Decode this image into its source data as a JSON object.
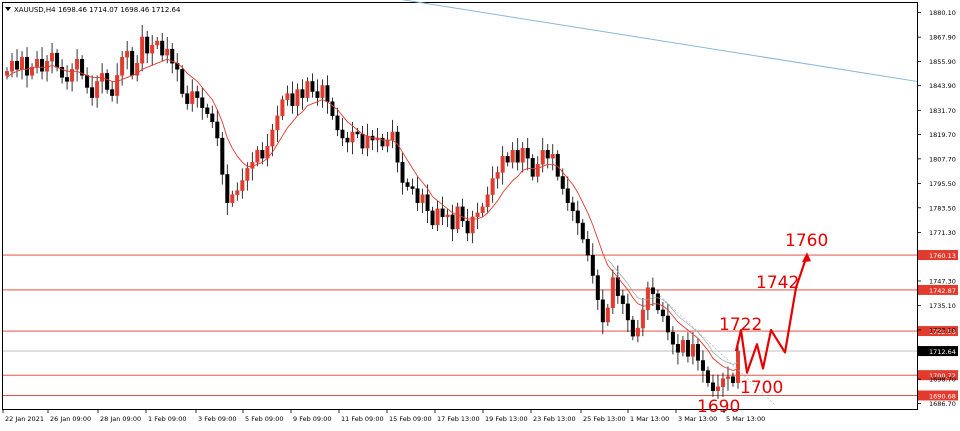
{
  "header": {
    "symbol": "XAUUSD,H4",
    "ohlc": "1698.46 1714.07 1698.46 1712.64"
  },
  "chart_data": {
    "type": "candlestick",
    "ylim": [
      1684,
      1892
    ],
    "y_ticks": [
      1880.1,
      1867.9,
      1855.9,
      1843.9,
      1831.7,
      1819.7,
      1807.7,
      1795.5,
      1783.5,
      1771.3,
      1747.3,
      1735.1,
      1723.1,
      1698.7,
      1686.7
    ],
    "x_labels": [
      "22 Jan 2021",
      "26 Jan 09:00",
      "28 Jan 09:00",
      "1 Feb 09:00",
      "3 Feb 09:00",
      "5 Feb 09:00",
      "9 Feb 09:00",
      "11 Feb 09:00",
      "15 Feb 09:00",
      "17 Feb 13:00",
      "19 Feb 13:00",
      "23 Feb 13:00",
      "25 Feb 13:00",
      "1 Mar 13:00",
      "3 Mar 13:00",
      "5 Mar 13:00"
    ],
    "levels": [
      {
        "label": "1760.13",
        "value": 1760.13
      },
      {
        "label": "1742.87",
        "value": 1742.87
      },
      {
        "label": "1722.53",
        "value": 1722.53
      },
      {
        "label": "1700.72",
        "value": 1700.72
      },
      {
        "label": "1690.68",
        "value": 1690.68
      }
    ],
    "current_price": {
      "label": "1712.64",
      "value": 1712.64
    },
    "annotations": [
      {
        "text": "1760",
        "price": 1760
      },
      {
        "text": "1742",
        "price": 1742
      },
      {
        "text": "1722",
        "price": 1722
      },
      {
        "text": "1700",
        "price": 1700
      },
      {
        "text": "1690",
        "price": 1690
      }
    ],
    "forecast_path": [
      1712.6,
      1723,
      1702,
      1716,
      1704,
      1723,
      1712,
      1744,
      1760
    ],
    "trendline": {
      "from": 1897,
      "to": 1846
    },
    "close_series": [
      1851,
      1856,
      1852,
      1858,
      1849,
      1853,
      1857,
      1851,
      1856,
      1860,
      1853,
      1848,
      1846,
      1852,
      1857,
      1849,
      1843,
      1838,
      1846,
      1850,
      1842,
      1839,
      1849,
      1858,
      1861,
      1849,
      1855,
      1868,
      1860,
      1864,
      1866,
      1859,
      1862,
      1855,
      1852,
      1840,
      1835,
      1841,
      1838,
      1833,
      1830,
      1826,
      1818,
      1800,
      1786,
      1790,
      1792,
      1797,
      1803,
      1806,
      1812,
      1808,
      1814,
      1822,
      1829,
      1837,
      1840,
      1834,
      1842,
      1838,
      1846,
      1841,
      1838,
      1844,
      1836,
      1829,
      1822,
      1818,
      1816,
      1821,
      1820,
      1813,
      1819,
      1817,
      1818,
      1814,
      1817,
      1821,
      1806,
      1796,
      1794,
      1793,
      1786,
      1790,
      1782,
      1775,
      1783,
      1779,
      1780,
      1773,
      1784,
      1777,
      1771,
      1779,
      1781,
      1784,
      1790,
      1798,
      1801,
      1809,
      1806,
      1812,
      1806,
      1813,
      1808,
      1799,
      1805,
      1812,
      1808,
      1810,
      1799,
      1793,
      1786,
      1782,
      1776,
      1768,
      1760,
      1750,
      1738,
      1727,
      1734,
      1749,
      1740,
      1736,
      1728,
      1720,
      1724,
      1733,
      1744,
      1741,
      1733,
      1730,
      1722,
      1716,
      1712,
      1718,
      1710,
      1716,
      1708,
      1703,
      1697,
      1693,
      1695,
      1699,
      1700,
      1697,
      1712.64
    ],
    "ma_series": [
      1848,
      1850,
      1851,
      1852,
      1852,
      1853,
      1853,
      1853,
      1853,
      1854,
      1853,
      1852,
      1851,
      1851,
      1851,
      1850,
      1849,
      1848,
      1848,
      1848,
      1847,
      1846,
      1846,
      1847,
      1848,
      1849,
      1850,
      1852,
      1853,
      1854,
      1855,
      1856,
      1857,
      1856,
      1855,
      1853,
      1850,
      1848,
      1846,
      1843,
      1840,
      1837,
      1832,
      1826,
      1818,
      1813,
      1809,
      1806,
      1804,
      1804,
      1805,
      1806,
      1808,
      1811,
      1815,
      1819,
      1823,
      1826,
      1829,
      1831,
      1834,
      1835,
      1836,
      1837,
      1836,
      1834,
      1832,
      1829,
      1826,
      1824,
      1822,
      1820,
      1819,
      1818,
      1818,
      1817,
      1817,
      1817,
      1815,
      1811,
      1807,
      1803,
      1799,
      1796,
      1793,
      1789,
      1787,
      1785,
      1783,
      1781,
      1780,
      1779,
      1778,
      1778,
      1778,
      1779,
      1781,
      1784,
      1787,
      1791,
      1794,
      1797,
      1799,
      1802,
      1803,
      1803,
      1803,
      1804,
      1805,
      1805,
      1804,
      1801,
      1798,
      1795,
      1791,
      1786,
      1781,
      1775,
      1768,
      1761,
      1755,
      1752,
      1749,
      1746,
      1743,
      1739,
      1736,
      1735,
      1735,
      1736,
      1736,
      1735,
      1733,
      1730,
      1727,
      1725,
      1723,
      1721,
      1719,
      1716,
      1713,
      1709,
      1707,
      1705,
      1704,
      1703,
      1704
    ]
  }
}
